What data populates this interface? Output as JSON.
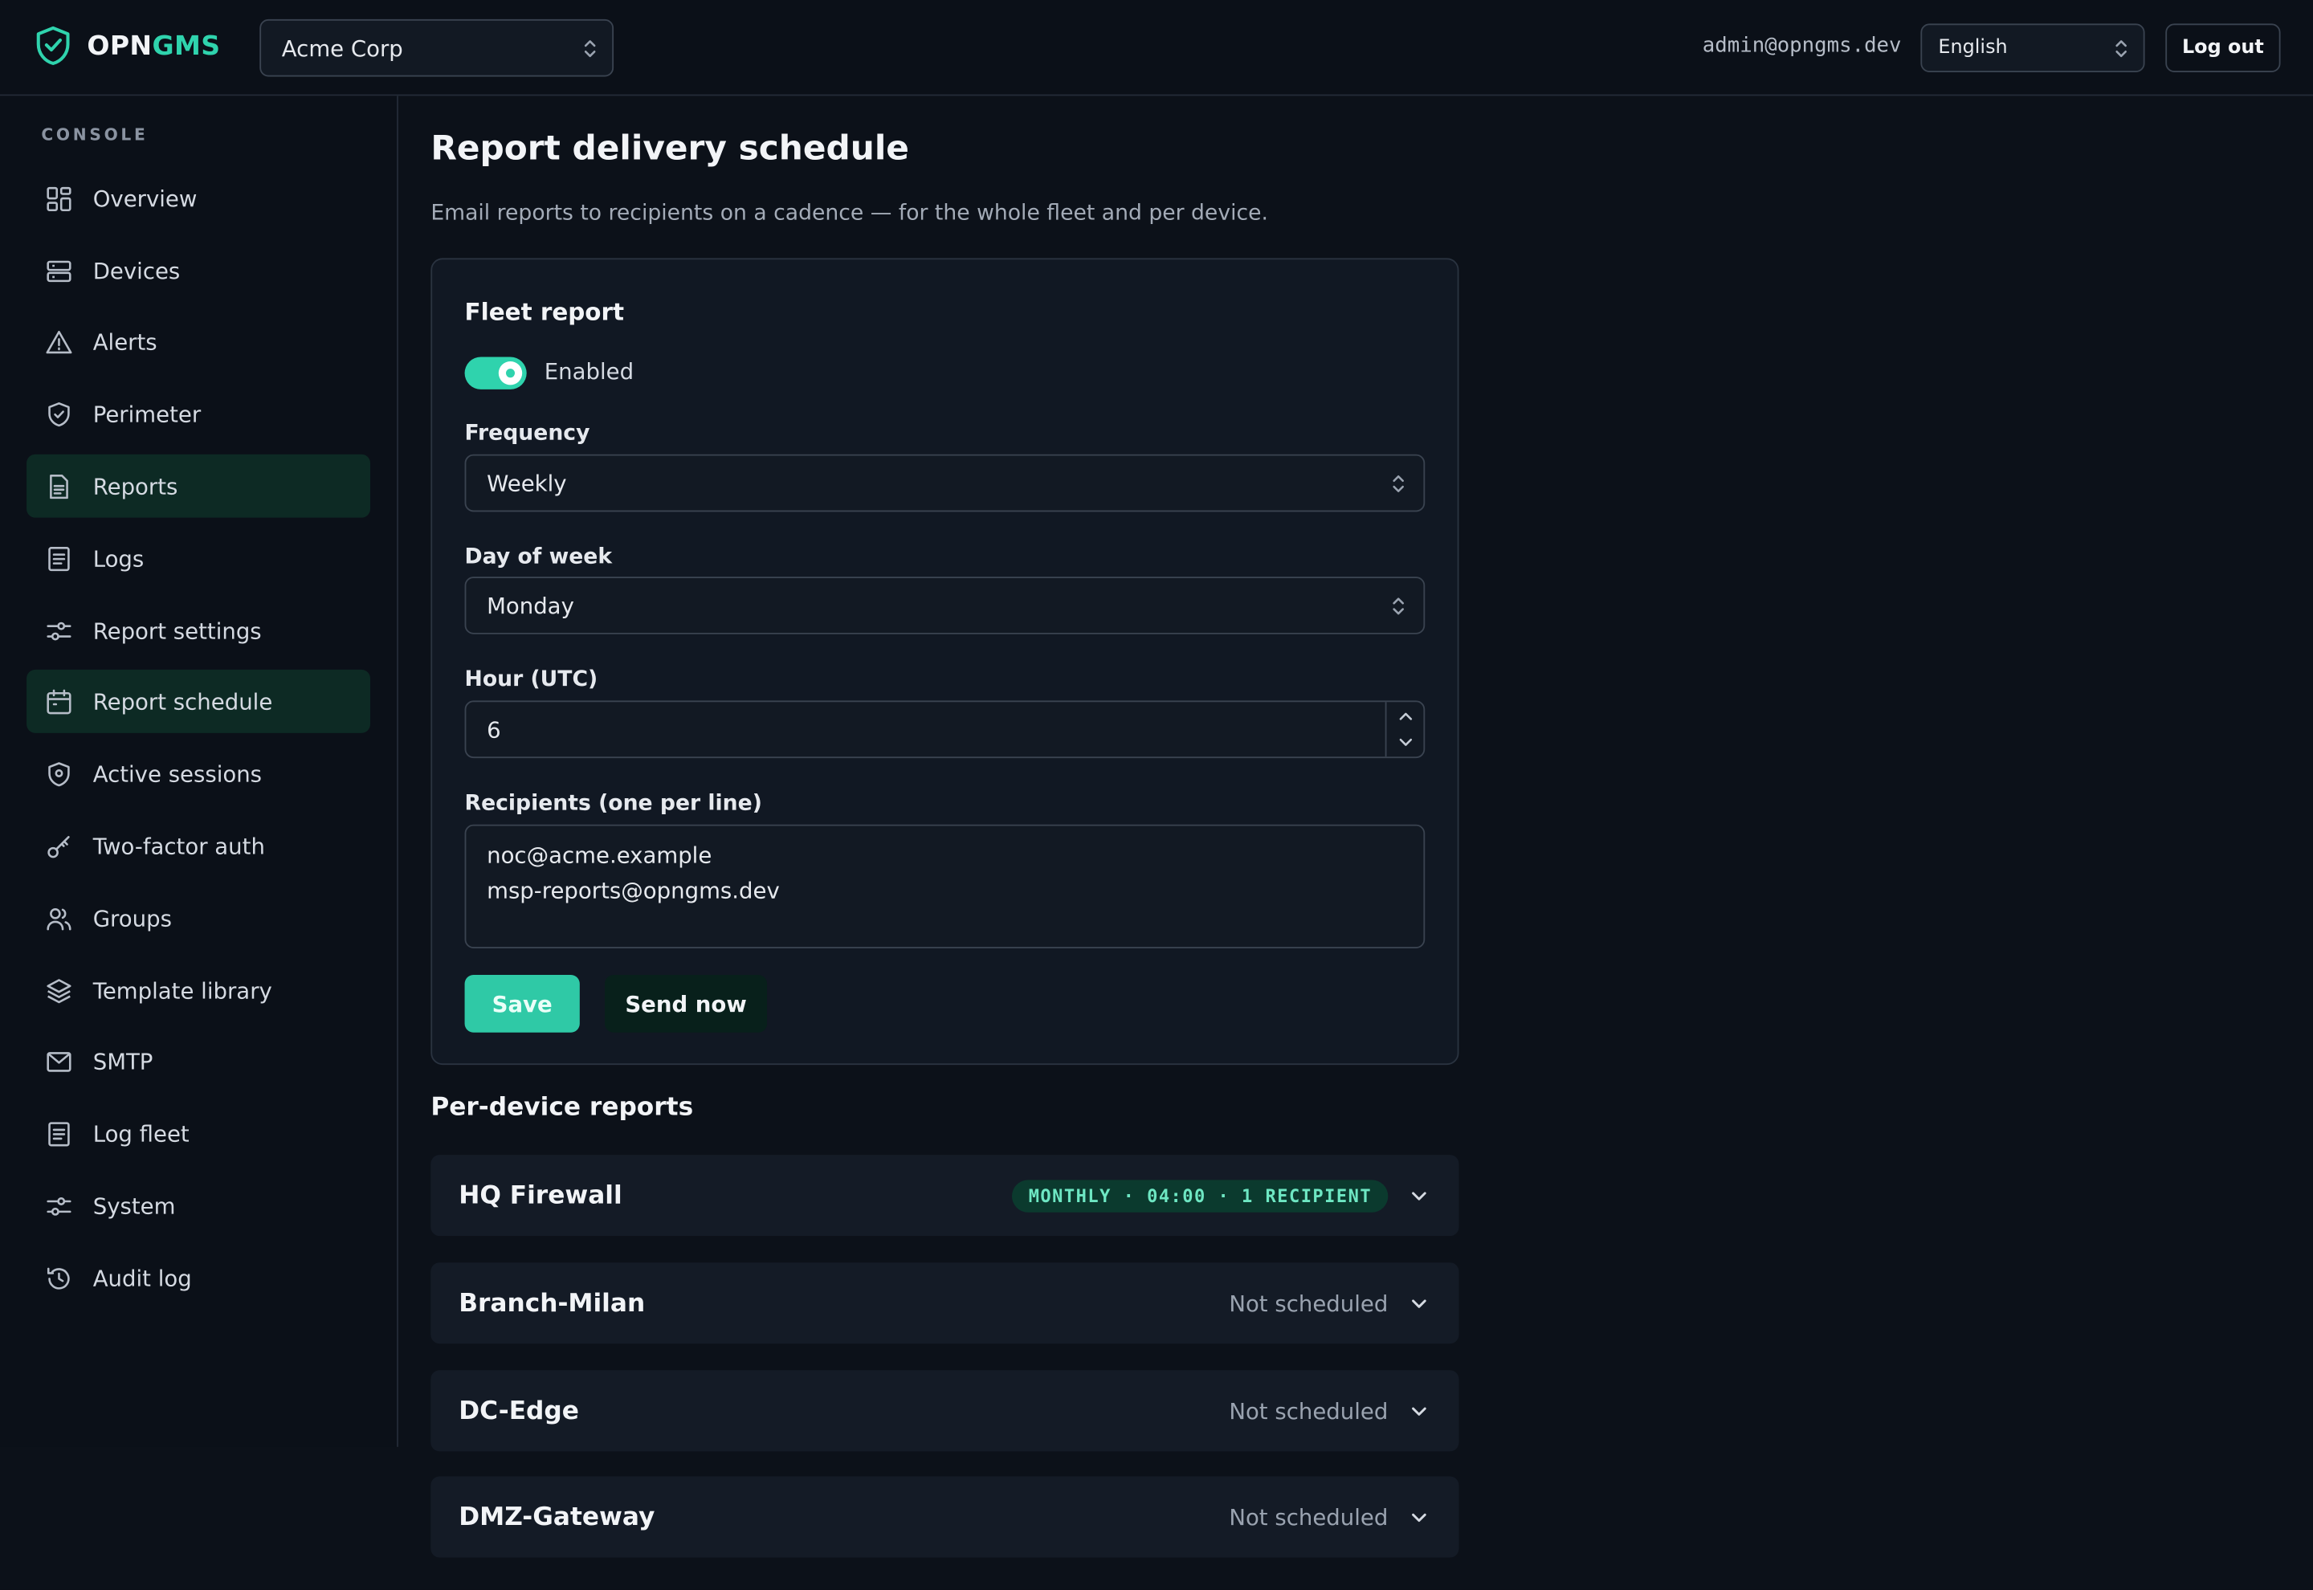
{
  "header": {
    "brand_primary": "OPN",
    "brand_accent": "GMS",
    "org_select": "Acme Corp",
    "admin_email": "admin@opngms.dev",
    "language_select": "English",
    "logout_label": "Log out"
  },
  "sidebar": {
    "section_label": "CONSOLE",
    "items": [
      {
        "label": "Overview",
        "icon": "grid-icon"
      },
      {
        "label": "Devices",
        "icon": "server-icon"
      },
      {
        "label": "Alerts",
        "icon": "warning-icon"
      },
      {
        "label": "Perimeter",
        "icon": "shield-icon"
      },
      {
        "label": "Reports",
        "icon": "document-icon"
      },
      {
        "label": "Logs",
        "icon": "list-icon"
      },
      {
        "label": "Report settings",
        "icon": "sliders-icon"
      },
      {
        "label": "Report schedule",
        "icon": "calendar-icon"
      },
      {
        "label": "Active sessions",
        "icon": "location-icon"
      },
      {
        "label": "Two-factor auth",
        "icon": "key-icon"
      },
      {
        "label": "Groups",
        "icon": "users-icon"
      },
      {
        "label": "Template library",
        "icon": "layers-icon"
      },
      {
        "label": "SMTP",
        "icon": "mail-icon"
      },
      {
        "label": "Log fleet",
        "icon": "list-icon"
      },
      {
        "label": "System",
        "icon": "sliders-icon"
      },
      {
        "label": "Audit log",
        "icon": "history-icon"
      }
    ]
  },
  "page": {
    "title": "Report delivery schedule",
    "subtitle": "Email reports to recipients on a cadence — for the whole fleet and per device."
  },
  "fleet_report": {
    "title": "Fleet report",
    "enabled": true,
    "enabled_label": "Enabled",
    "frequency_label": "Frequency",
    "frequency_value": "Weekly",
    "day_label": "Day of week",
    "day_value": "Monday",
    "hour_label": "Hour (UTC)",
    "hour_value": "6",
    "recipients_label": "Recipients (one per line)",
    "recipients_line1": "noc@acme.example",
    "recipients_line2": "msp-reports@opngms.dev",
    "save_label": "Save",
    "send_now_label": "Send now"
  },
  "per_device": {
    "title": "Per-device reports",
    "devices": [
      {
        "name": "HQ Firewall",
        "status": "MONTHLY · 04:00 · 1 RECIPIENT"
      },
      {
        "name": "Branch-Milan",
        "status": "Not scheduled"
      },
      {
        "name": "DC-Edge",
        "status": "Not scheduled"
      },
      {
        "name": "DMZ-Gateway",
        "status": "Not scheduled"
      }
    ]
  },
  "colors": {
    "accent": "#2fd3ad",
    "background": "#0c1119",
    "card": "#111823",
    "active_nav": "#0d2a24"
  }
}
